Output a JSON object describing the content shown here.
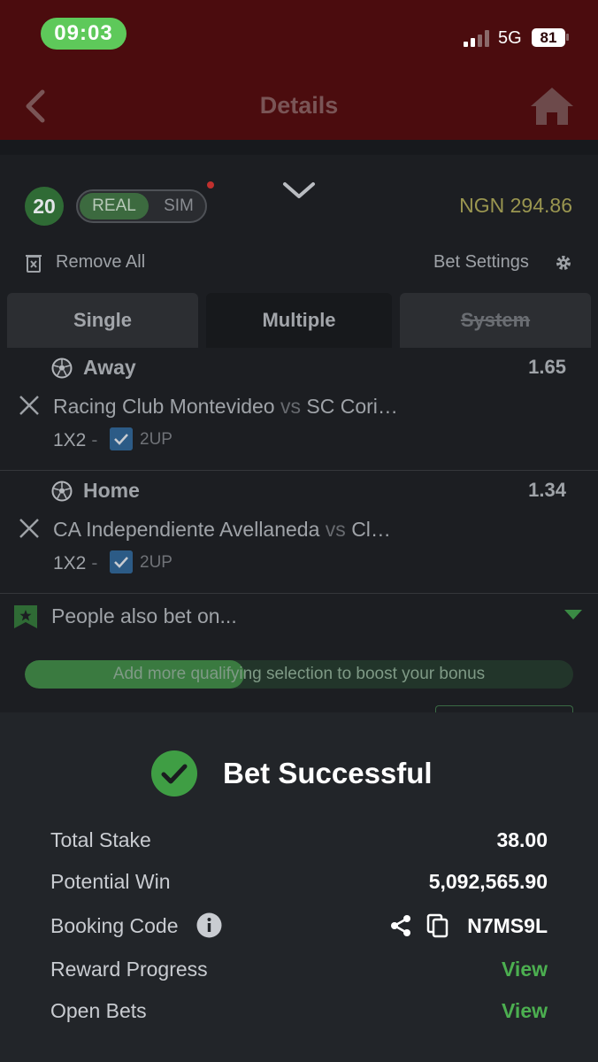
{
  "status_bar": {
    "time": "09:03",
    "network": "5G",
    "battery": "81"
  },
  "header": {
    "title": "Details"
  },
  "betslip": {
    "count": "20",
    "mode": {
      "real": "REAL",
      "sim": "SIM",
      "selected": "REAL"
    },
    "balance": "NGN 294.86",
    "remove_all": "Remove All",
    "bet_settings": "Bet Settings",
    "tabs": [
      {
        "label": "Single",
        "state": "inactive"
      },
      {
        "label": "Multiple",
        "state": "active"
      },
      {
        "label": "System",
        "state": "disabled"
      }
    ],
    "selections": [
      {
        "pick": "Away",
        "odds": "1.65",
        "home_team": "Racing Club Montevideo",
        "vs": "vs",
        "away_team": "SC Cori…",
        "market": "1X2",
        "dash": "-",
        "two_up": "2UP"
      },
      {
        "pick": "Home",
        "odds": "1.34",
        "home_team": "CA Independiente Avellaneda",
        "vs": "vs",
        "away_team": "Cl…",
        "market": "1X2",
        "dash": "-",
        "two_up": "2UP"
      }
    ],
    "people_also_bet": "People also bet on...",
    "bonus_progress": {
      "text": "Add more qualifying selection to boost your bonus",
      "fill_fraction": 0.4
    }
  },
  "success": {
    "title": "Bet Successful",
    "rows": {
      "total_stake_label": "Total Stake",
      "total_stake_value": "38.00",
      "potential_win_label": "Potential Win",
      "potential_win_value": "5,092,565.90",
      "booking_code_label": "Booking Code",
      "booking_code_value": "N7MS9L",
      "reward_progress_label": "Reward Progress",
      "reward_progress_link": "View",
      "open_bets_label": "Open Bets",
      "open_bets_link": "View"
    }
  },
  "icons": {
    "back": "chevron-left-icon",
    "home": "home-icon",
    "collapse": "chevron-down-icon",
    "remove": "trash-icon",
    "settings": "gear-icon",
    "sport": "soccer-ball-icon",
    "close": "close-icon",
    "check": "checkbox-checked-icon",
    "bookmark": "bookmark-star-icon",
    "success": "check-circle-icon",
    "info": "info-icon",
    "share": "share-icon",
    "copy": "copy-icon"
  },
  "colors": {
    "header_bg": "#4b0c0e",
    "accent_green": "#4caf50",
    "balance": "#9a9650",
    "panel": "#1c1e22",
    "sheet": "#222529"
  }
}
